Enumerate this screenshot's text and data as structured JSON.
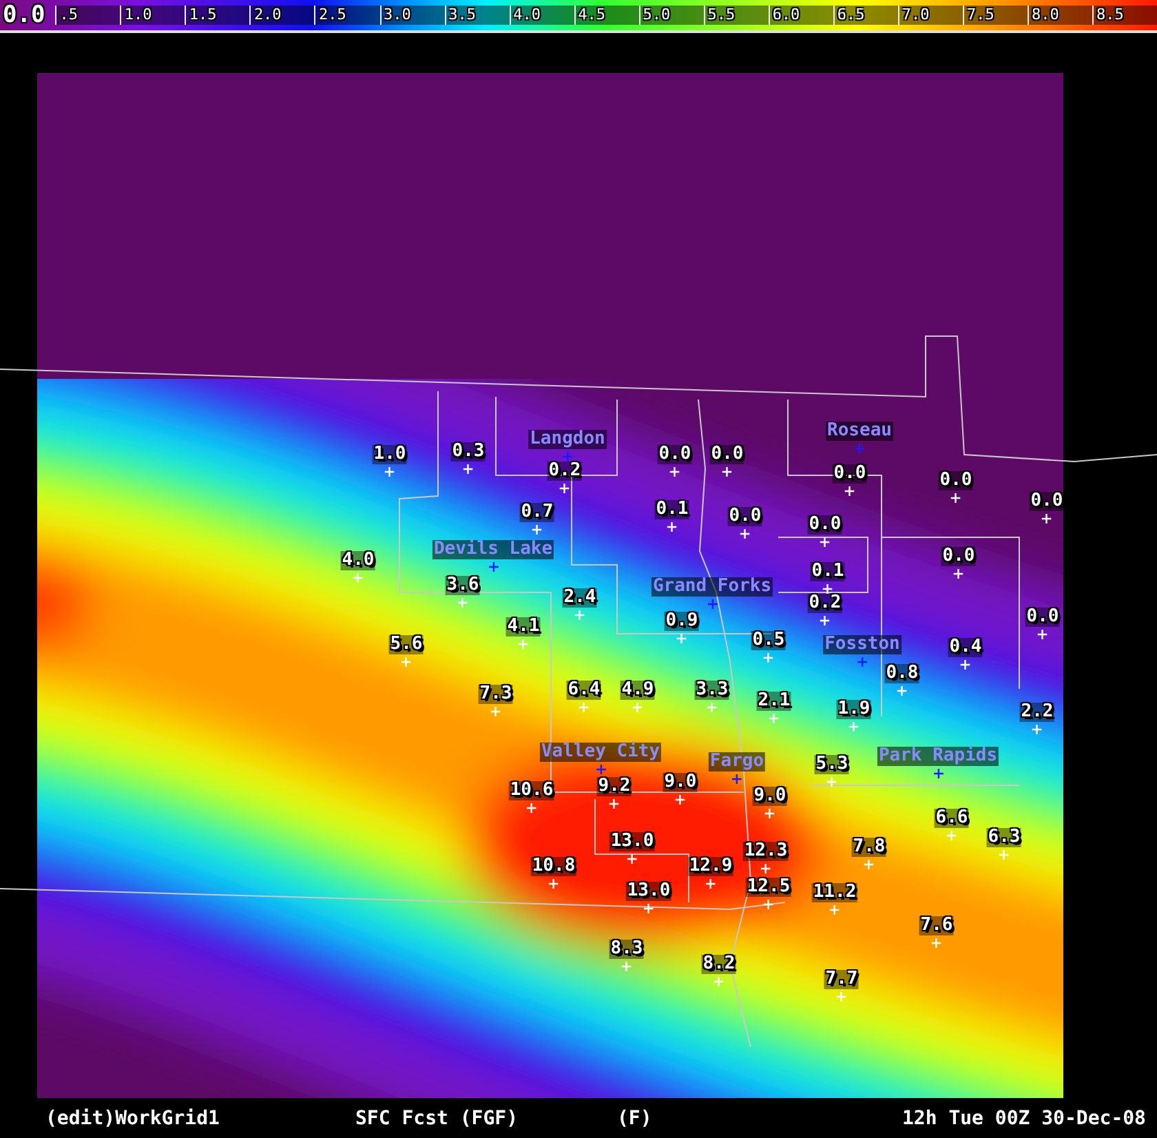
{
  "color_scale": {
    "current_value": "0.0",
    "labels": [
      ".5",
      "1.0",
      "1.5",
      "2.0",
      "2.5",
      "3.0",
      "3.5",
      "4.0",
      "4.5",
      "5.0",
      "5.5",
      "6.0",
      "6.5",
      "7.0",
      "7.5",
      "8.0",
      "8.5"
    ]
  },
  "map": {
    "stations": [
      {
        "value": "1.0"
      },
      {
        "value": "0.3"
      },
      {
        "value": "0.2"
      },
      {
        "value": "0.0"
      },
      {
        "value": "0.0"
      },
      {
        "value": "0.0"
      },
      {
        "value": "0.0"
      },
      {
        "value": "0.0"
      },
      {
        "value": "0.7"
      },
      {
        "value": "0.1"
      },
      {
        "value": "0.0"
      },
      {
        "value": "0.0"
      },
      {
        "value": "0.0"
      },
      {
        "value": "4.0"
      },
      {
        "value": "3.6"
      },
      {
        "value": "2.4"
      },
      {
        "value": "0.1"
      },
      {
        "value": "0.2"
      },
      {
        "value": "0.9"
      },
      {
        "value": "0.0"
      },
      {
        "value": "4.1"
      },
      {
        "value": "5.6"
      },
      {
        "value": "0.5"
      },
      {
        "value": "0.4"
      },
      {
        "value": "0.8"
      },
      {
        "value": "7.3"
      },
      {
        "value": "6.4"
      },
      {
        "value": "4.9"
      },
      {
        "value": "3.3"
      },
      {
        "value": "2.1"
      },
      {
        "value": "1.9"
      },
      {
        "value": "2.2"
      },
      {
        "value": "5.3"
      },
      {
        "value": "10.6"
      },
      {
        "value": "9.2"
      },
      {
        "value": "9.0"
      },
      {
        "value": "9.0"
      },
      {
        "value": "6.6"
      },
      {
        "value": "6.3"
      },
      {
        "value": "13.0"
      },
      {
        "value": "12.3"
      },
      {
        "value": "7.8"
      },
      {
        "value": "10.8"
      },
      {
        "value": "12.9"
      },
      {
        "value": "13.0"
      },
      {
        "value": "12.5"
      },
      {
        "value": "11.2"
      },
      {
        "value": "7.6"
      },
      {
        "value": "8.3"
      },
      {
        "value": "8.2"
      },
      {
        "value": "7.7"
      }
    ],
    "cities": [
      {
        "name": "Langdon"
      },
      {
        "name": "Roseau"
      },
      {
        "name": "Devils Lake"
      },
      {
        "name": "Grand Forks"
      },
      {
        "name": "Fosston"
      },
      {
        "name": "Valley City"
      },
      {
        "name": "Fargo"
      },
      {
        "name": "Park Rapids"
      }
    ]
  },
  "status_bar": {
    "grid": "(edit)WorkGrid1",
    "source": "SFC Fcst (FGF)",
    "units": "(F)",
    "time": "12h Tue 00Z 30-Dec-08"
  }
}
